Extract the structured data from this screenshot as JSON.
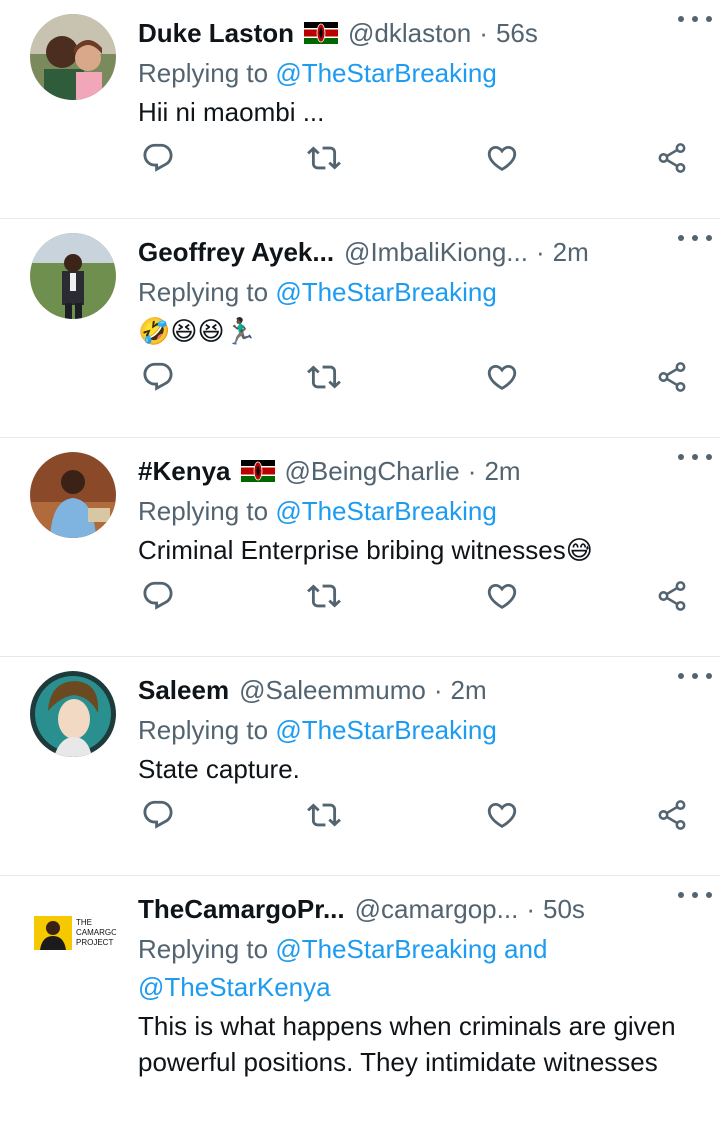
{
  "tweets": [
    {
      "name": "Duke Laston",
      "has_flag": true,
      "handle": "@dklaston",
      "sep": "·",
      "time": "56s",
      "reply_prefix": "Replying to",
      "reply_to": "@TheStarBreaking",
      "text": "Hii ni maombi ..."
    },
    {
      "name": "Geoffrey Ayek...",
      "has_flag": false,
      "handle": "@ImbaliKiong...",
      "sep": "·",
      "time": "2m",
      "reply_prefix": "Replying to",
      "reply_to": "@TheStarBreaking",
      "text": "🤣😆😆🏃🏿‍♂️"
    },
    {
      "name": "#Kenya",
      "has_flag": true,
      "handle": "@BeingCharlie",
      "sep": "·",
      "time": "2m",
      "reply_prefix": "Replying to",
      "reply_to": "@TheStarBreaking",
      "text": "Criminal Enterprise bribing witnesses😅"
    },
    {
      "name": "Saleem",
      "has_flag": false,
      "handle": "@Saleemmumo",
      "sep": "·",
      "time": "2m",
      "reply_prefix": "Replying to",
      "reply_to": "@TheStarBreaking",
      "text": "State capture."
    },
    {
      "name": "TheCamargoPr...",
      "has_flag": false,
      "handle": "@camargop...",
      "sep": "·",
      "time": "50s",
      "reply_prefix": "Replying to",
      "reply_to": "@TheStarBreaking and",
      "reply_to_2": "@TheStarKenya",
      "text": "This is what happens when criminals are given powerful positions. They intimidate witnesses",
      "avatar_logo_text": [
        "THE",
        "CAMARGO",
        "PROJECT"
      ]
    }
  ],
  "colors": {
    "link": "#1d9bf0",
    "secondary": "#536471",
    "primary": "#0f1419",
    "divider": "#e6e9ec"
  },
  "icons": [
    "reply-icon",
    "retweet-icon",
    "like-icon",
    "share-icon",
    "more-icon",
    "kenya-flag-icon"
  ]
}
